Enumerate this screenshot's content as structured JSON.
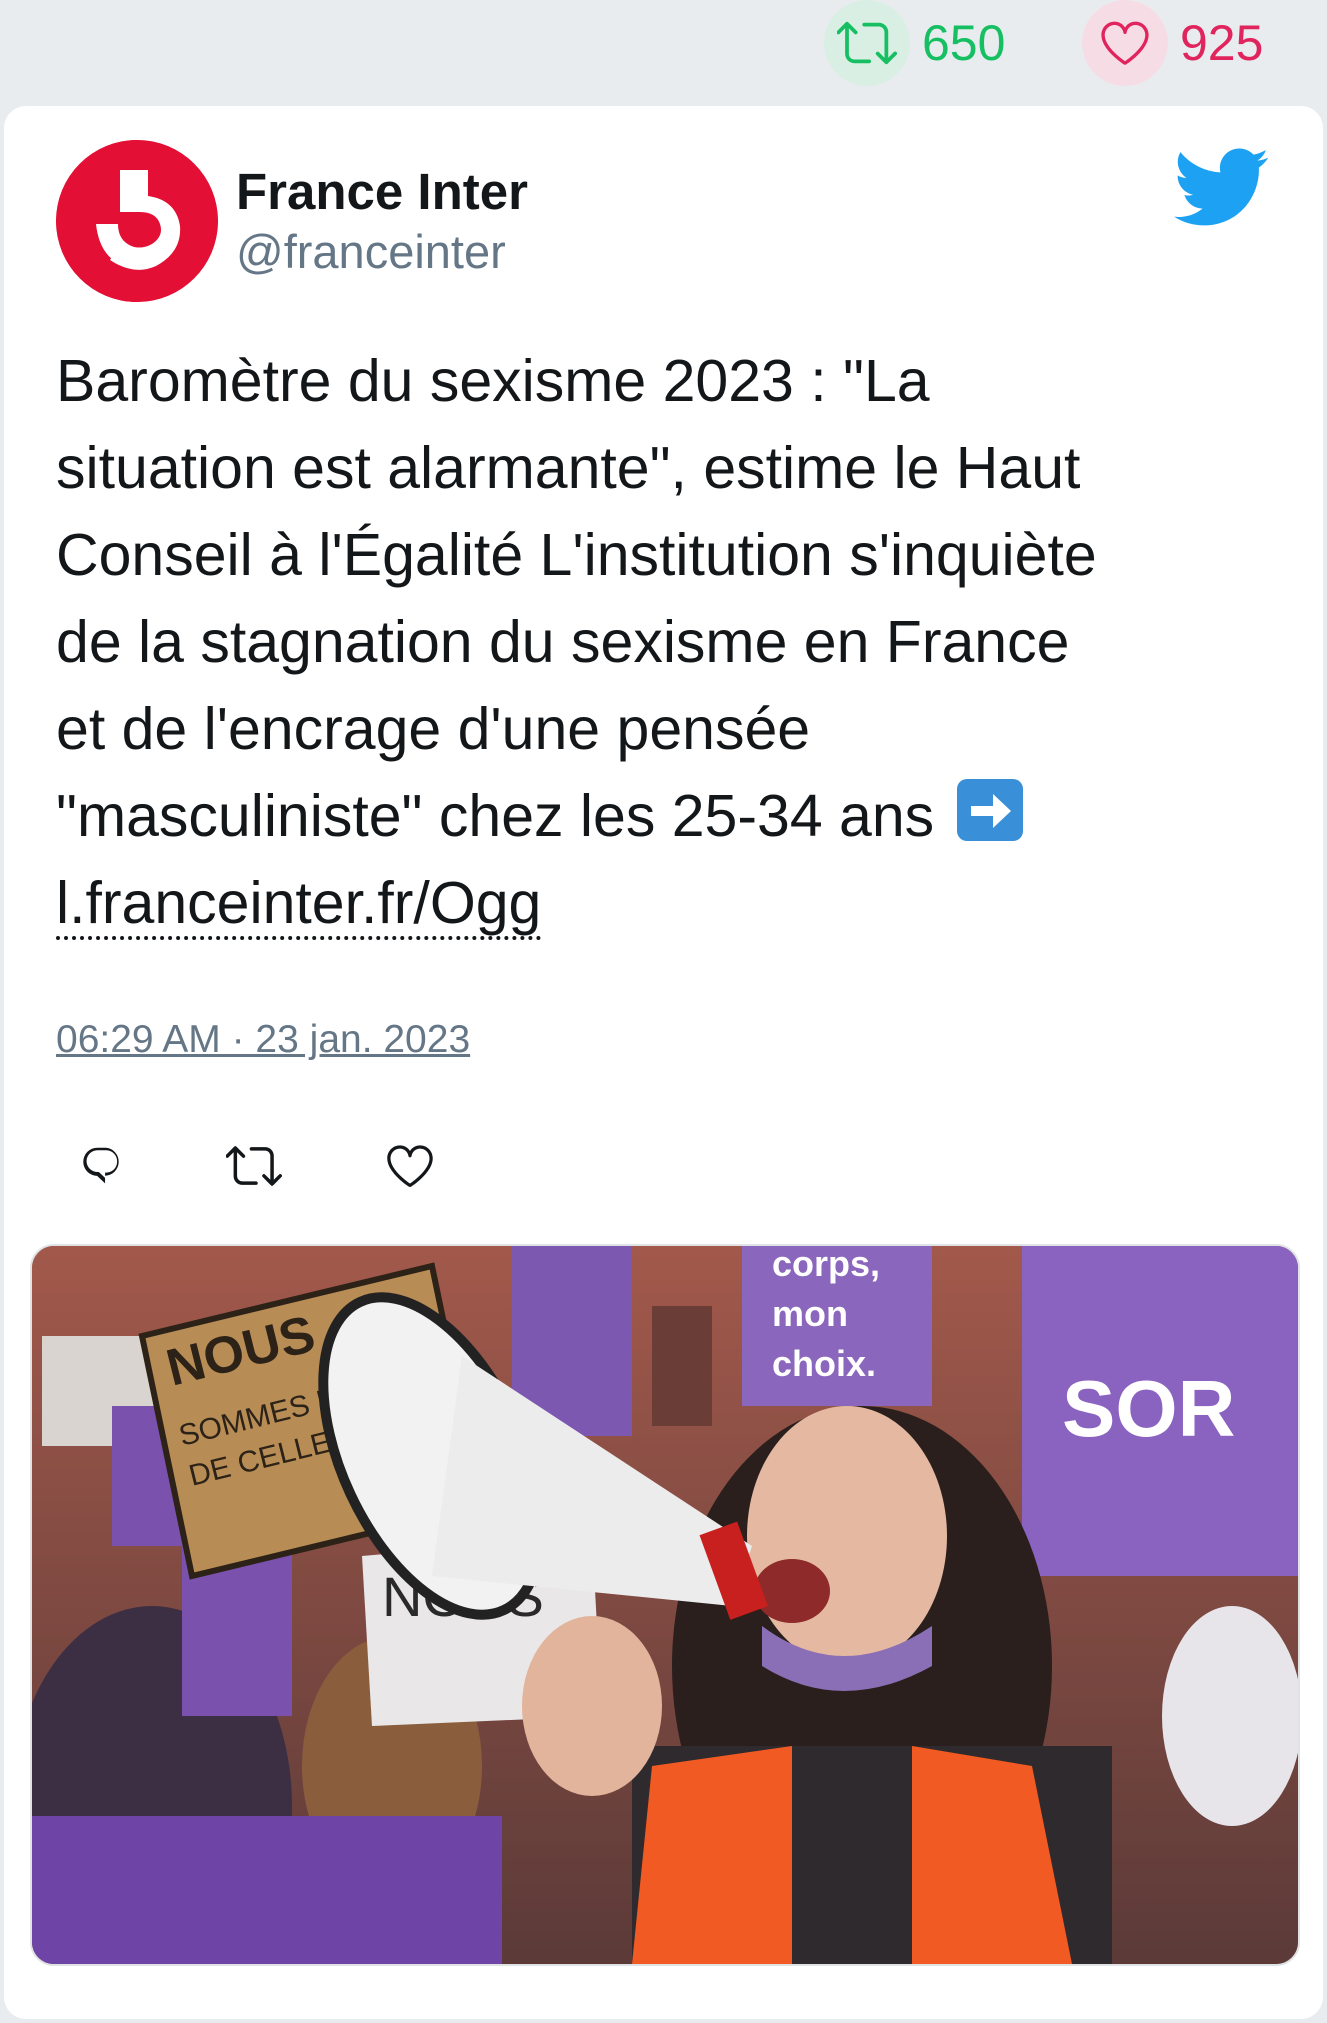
{
  "stats": {
    "retweet_count": "650",
    "like_count": "925",
    "retweet_icon": "retweet-icon",
    "like_icon": "heart-icon"
  },
  "tweet": {
    "author": {
      "display_name": "France Inter",
      "handle": "@franceinter"
    },
    "text_lines": [
      "Baromètre du sexisme 2023 : \"La",
      "situation est alarmante\", estime le Haut",
      "Conseil à l'Égalité L'institution s'inquiète",
      "de la stagnation du sexisme en France",
      "et de l'encrage d'une pensée",
      "\"masculiniste\" chez les 25-34 ans"
    ],
    "emoji": "arrow-right-emoji",
    "link": "l.franceinter.fr/Ogg",
    "timestamp": "06:29 AM · 23 jan. 2023",
    "actions": [
      "reply-icon",
      "retweet-icon",
      "like-icon"
    ]
  },
  "media": {
    "sign_nous": "NOUS",
    "sign_sommes": "SOMMES LA VOIX",
    "sign_celles": "DE CELLES QUI",
    "sign_mon_corps": "corps,",
    "sign_mon": "mon",
    "sign_choix": "choix.",
    "sign_sor": "SOR",
    "sign_nous2": "NOUS"
  },
  "colors": {
    "retweet": "#17bf63",
    "like": "#e0245e",
    "twitter_blue": "#1da1f2",
    "brand_red": "#e30f34"
  }
}
